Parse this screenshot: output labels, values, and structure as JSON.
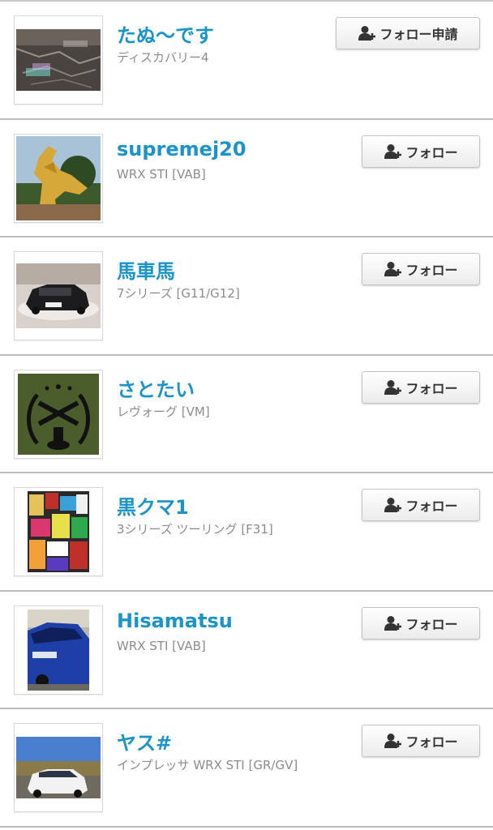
{
  "users": [
    {
      "name": "たぬ～です",
      "car": "ディスカバリー4",
      "button_label": "フォロー申請",
      "button_icon": "add-user-icon",
      "thumb": "thumb-cracked-surface"
    },
    {
      "name": "supremej20",
      "car": "WRX STI [VAB]",
      "button_label": "フォロー",
      "button_icon": "add-user-icon",
      "thumb": "thumb-golden-statue"
    },
    {
      "name": "馬車馬",
      "car": "7シリーズ [G11/G12]",
      "button_label": "フォロー",
      "button_icon": "add-user-icon",
      "thumb": "thumb-black-car"
    },
    {
      "name": "さとたい",
      "car": "レヴォーグ [VM]",
      "button_label": "フォロー",
      "button_icon": "add-user-icon",
      "thumb": "thumb-emblem"
    },
    {
      "name": "黒クマ1",
      "car": "3シリーズ ツーリング [F31]",
      "button_label": "フォロー",
      "button_icon": "add-user-icon",
      "thumb": "thumb-colorful-stickers"
    },
    {
      "name": "Hisamatsu",
      "car": "WRX STI [VAB]",
      "button_label": "フォロー",
      "button_icon": "add-user-icon",
      "thumb": "thumb-blue-car"
    },
    {
      "name": "ヤス#",
      "car": "インプレッサ WRX STI [GR/GV]",
      "button_label": "フォロー",
      "button_icon": "add-user-icon",
      "thumb": "thumb-white-car"
    }
  ],
  "colors": {
    "name": "#1a94c9",
    "subtext": "#8c8c8c",
    "divider": "#bdbdbd"
  }
}
